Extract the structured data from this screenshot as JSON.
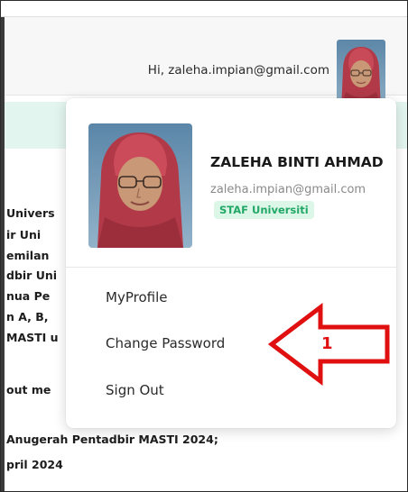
{
  "header": {
    "greeting": "Hi, zaleha.impian@gmail.com"
  },
  "background_text": {
    "lines": [
      "Univers",
      "ir  Uni",
      "emilan",
      "dbir Uni",
      "nua Pe",
      "n  A,  B,",
      "MASTI u",
      "out me",
      "Anugerah Pentadbir MASTI 2024;",
      "pril 2024"
    ]
  },
  "profile": {
    "name": "ZALEHA BINTI AHMAD",
    "email": "zaleha.impian@gmail.com",
    "role": "STAF Universiti"
  },
  "menu": {
    "items": [
      {
        "label": "MyProfile"
      },
      {
        "label": "Change Password"
      },
      {
        "label": "Sign Out"
      }
    ]
  },
  "annotation": {
    "number": "1",
    "color": "#e01010"
  },
  "colors": {
    "accent_green": "#22a866",
    "badge_bg": "#dcf6e8",
    "band_bg": "#e3f5ef"
  },
  "icons": {
    "header_avatar": "user-photo",
    "profile_photo": "user-photo"
  }
}
